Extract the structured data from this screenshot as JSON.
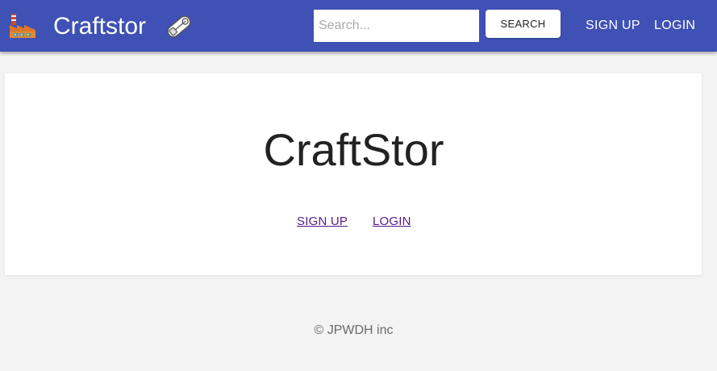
{
  "header": {
    "brand_title": "Craftstor",
    "search": {
      "placeholder": "Search...",
      "value": ""
    },
    "search_button_label": "SEARCH",
    "nav": {
      "signup_label": "SIGN UP",
      "login_label": "LOGIN"
    },
    "icons": {
      "left": "factory-icon",
      "right": "safety-pin-icon"
    },
    "background_color": "#3f51b5"
  },
  "main": {
    "hero_title": "CraftStor",
    "signup_label": "SIGN UP",
    "login_label": "LOGIN",
    "link_color": "#551a8b"
  },
  "footer": {
    "text": "© JPWDH inc"
  }
}
